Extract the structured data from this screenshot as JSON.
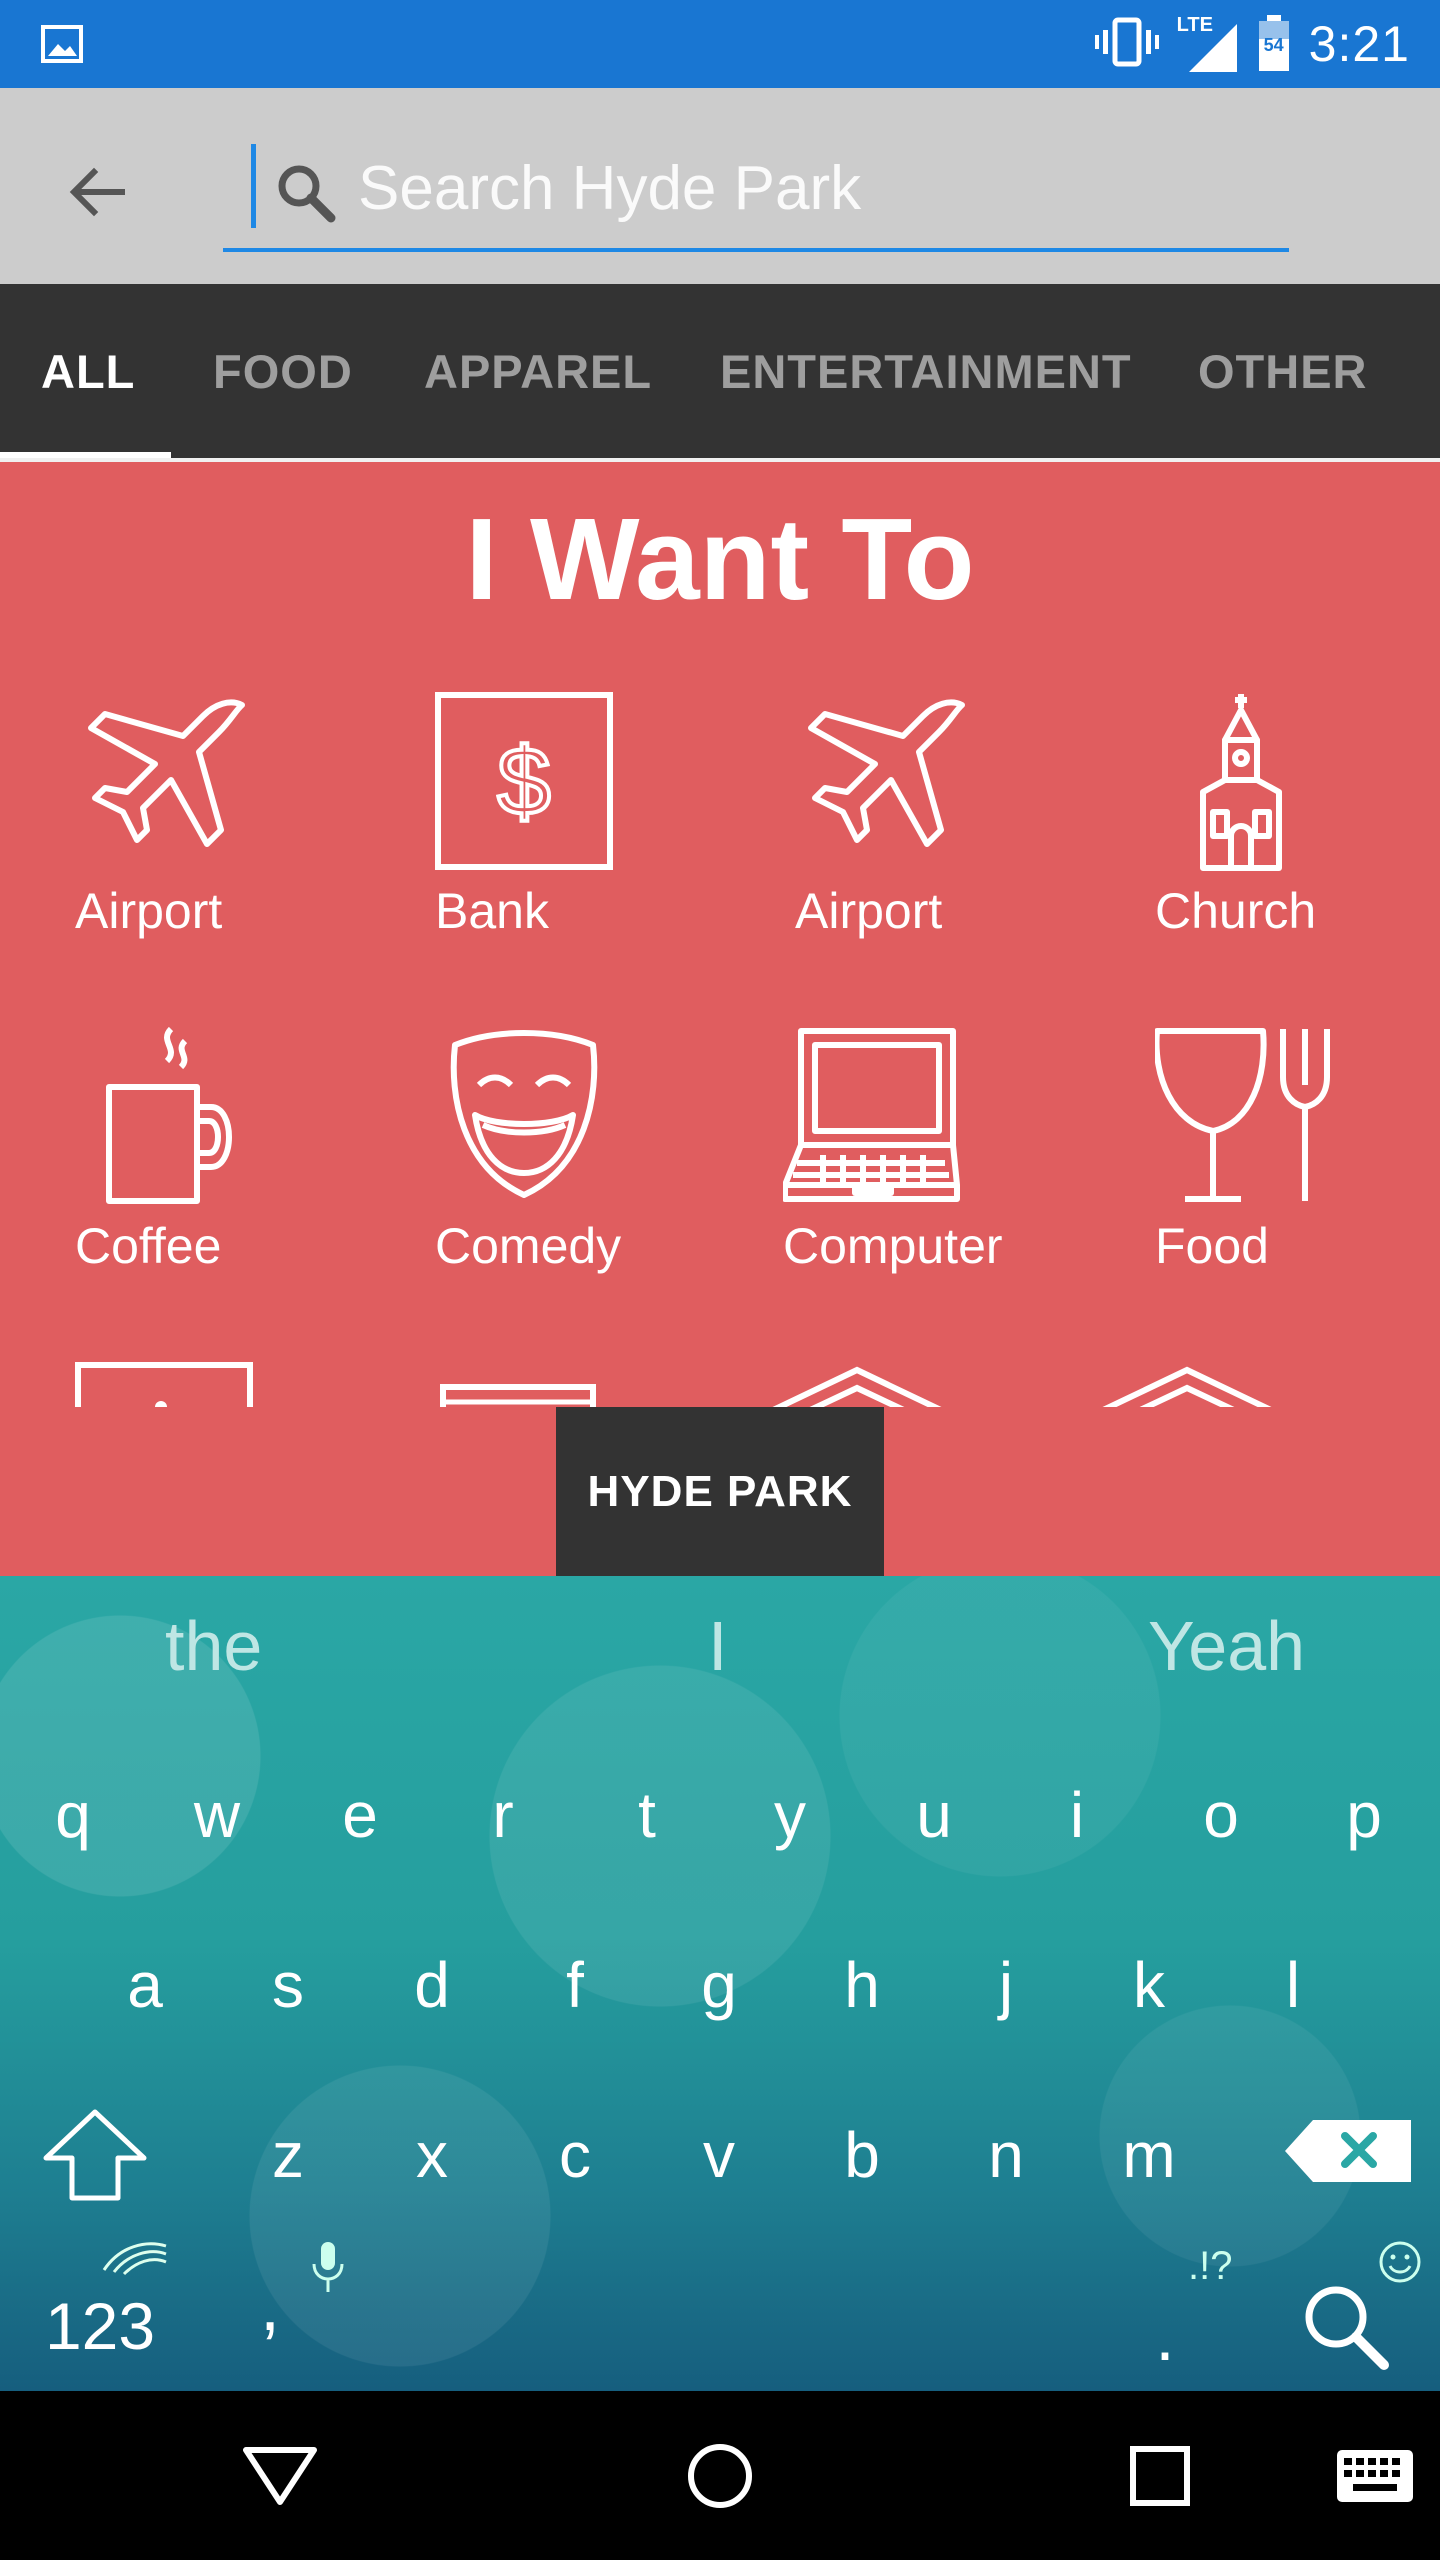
{
  "status_bar": {
    "time": "3:21",
    "network": "LTE",
    "battery": "54",
    "icons": [
      "image-icon",
      "vibrate-icon",
      "signal-icon",
      "battery-icon"
    ]
  },
  "search": {
    "placeholder": "Search Hyde Park",
    "value": ""
  },
  "tabs": [
    {
      "label": "ALL",
      "active": true
    },
    {
      "label": "FOOD",
      "active": false
    },
    {
      "label": "APPAREL",
      "active": false
    },
    {
      "label": "ENTERTAINMENT",
      "active": false
    },
    {
      "label": "OTHER",
      "active": false
    }
  ],
  "main": {
    "title": "I Want To",
    "categories": [
      {
        "label": "Airport",
        "icon": "airplane-icon"
      },
      {
        "label": "Bank",
        "icon": "bank-icon"
      },
      {
        "label": "Airport",
        "icon": "airplane-icon"
      },
      {
        "label": "Church",
        "icon": "church-icon"
      },
      {
        "label": "Coffee",
        "icon": "coffee-icon"
      },
      {
        "label": "Comedy",
        "icon": "comedy-icon"
      },
      {
        "label": "Computer",
        "icon": "computer-icon"
      },
      {
        "label": "Food",
        "icon": "food-icon"
      }
    ],
    "toast": "HYDE PARK"
  },
  "keyboard": {
    "suggestions": [
      "the",
      "I",
      "Yeah"
    ],
    "row1": [
      "q",
      "w",
      "e",
      "r",
      "t",
      "y",
      "u",
      "i",
      "o",
      "p"
    ],
    "row2": [
      "a",
      "s",
      "d",
      "f",
      "g",
      "h",
      "j",
      "k",
      "l"
    ],
    "row3": [
      "z",
      "x",
      "c",
      "v",
      "b",
      "n",
      "m"
    ],
    "numbers_key": "123",
    "comma_key": ",",
    "period_key": ".",
    "punct_hint": ".!?"
  },
  "colors": {
    "status_bar": "#1976d2",
    "header": "#cccccc",
    "tabs": "#333333",
    "main": "#e05d5f",
    "accent": "#1e88e5"
  }
}
